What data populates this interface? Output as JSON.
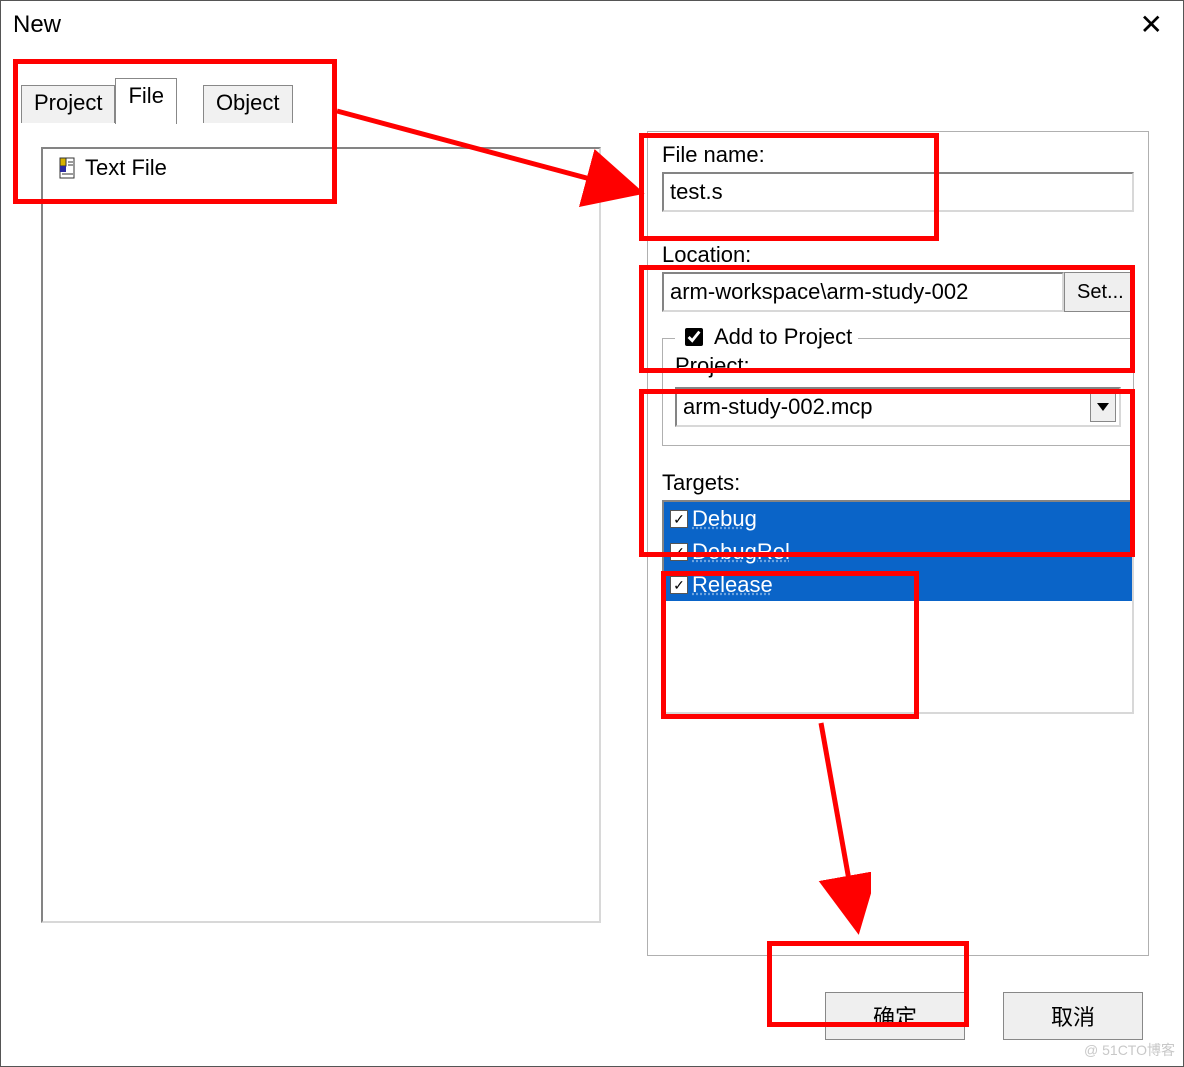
{
  "window": {
    "title": "New",
    "close_char": "✕"
  },
  "tabs": {
    "project": "Project",
    "file": "File",
    "object": "Object"
  },
  "file_list": {
    "item0": "Text File"
  },
  "right": {
    "file_name_label": "File name:",
    "file_name_value": "test.s",
    "location_label": "Location:",
    "location_value": "arm-workspace\\arm-study-002",
    "set_button": "Set...",
    "add_to_project_label": "Add to Project",
    "project_label": "Project:",
    "project_selected": "arm-study-002.mcp",
    "targets_label": "Targets:",
    "targets": [
      {
        "label": "Debug",
        "checked": true
      },
      {
        "label": "DebugRel",
        "checked": true
      },
      {
        "label": "Release",
        "checked": true
      }
    ]
  },
  "buttons": {
    "ok": "确定",
    "cancel": "取消"
  },
  "watermark": "@ 51CTO博客"
}
